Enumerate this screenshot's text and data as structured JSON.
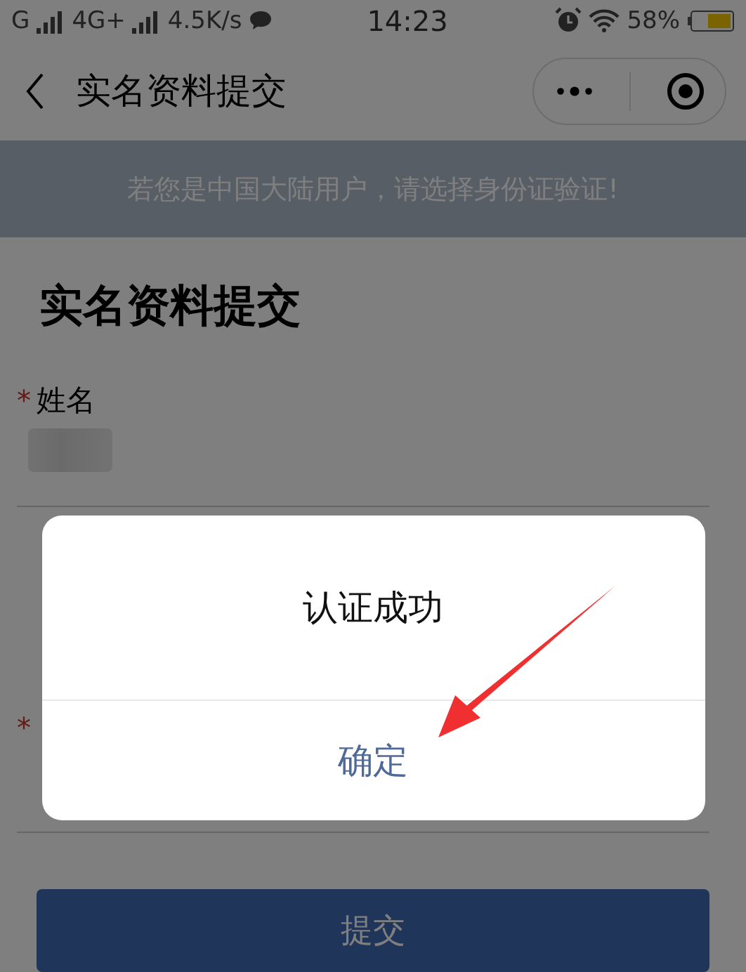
{
  "status_bar": {
    "carrier_1": "G",
    "carrier_2": "4G+",
    "speed": "4.5K/s",
    "time": "14:23",
    "battery": "58%"
  },
  "nav": {
    "title": "实名资料提交"
  },
  "notice": "若您是中国大陆用户，请选择身份证验证!",
  "heading": "实名资料提交",
  "fields": [
    {
      "required_mark": "*",
      "label": "姓名",
      "redacted": true
    },
    {
      "required_mark": "*",
      "redacted": false
    }
  ],
  "submit_button": "提交",
  "dialog": {
    "message": "认证成功",
    "confirm": "确定"
  }
}
